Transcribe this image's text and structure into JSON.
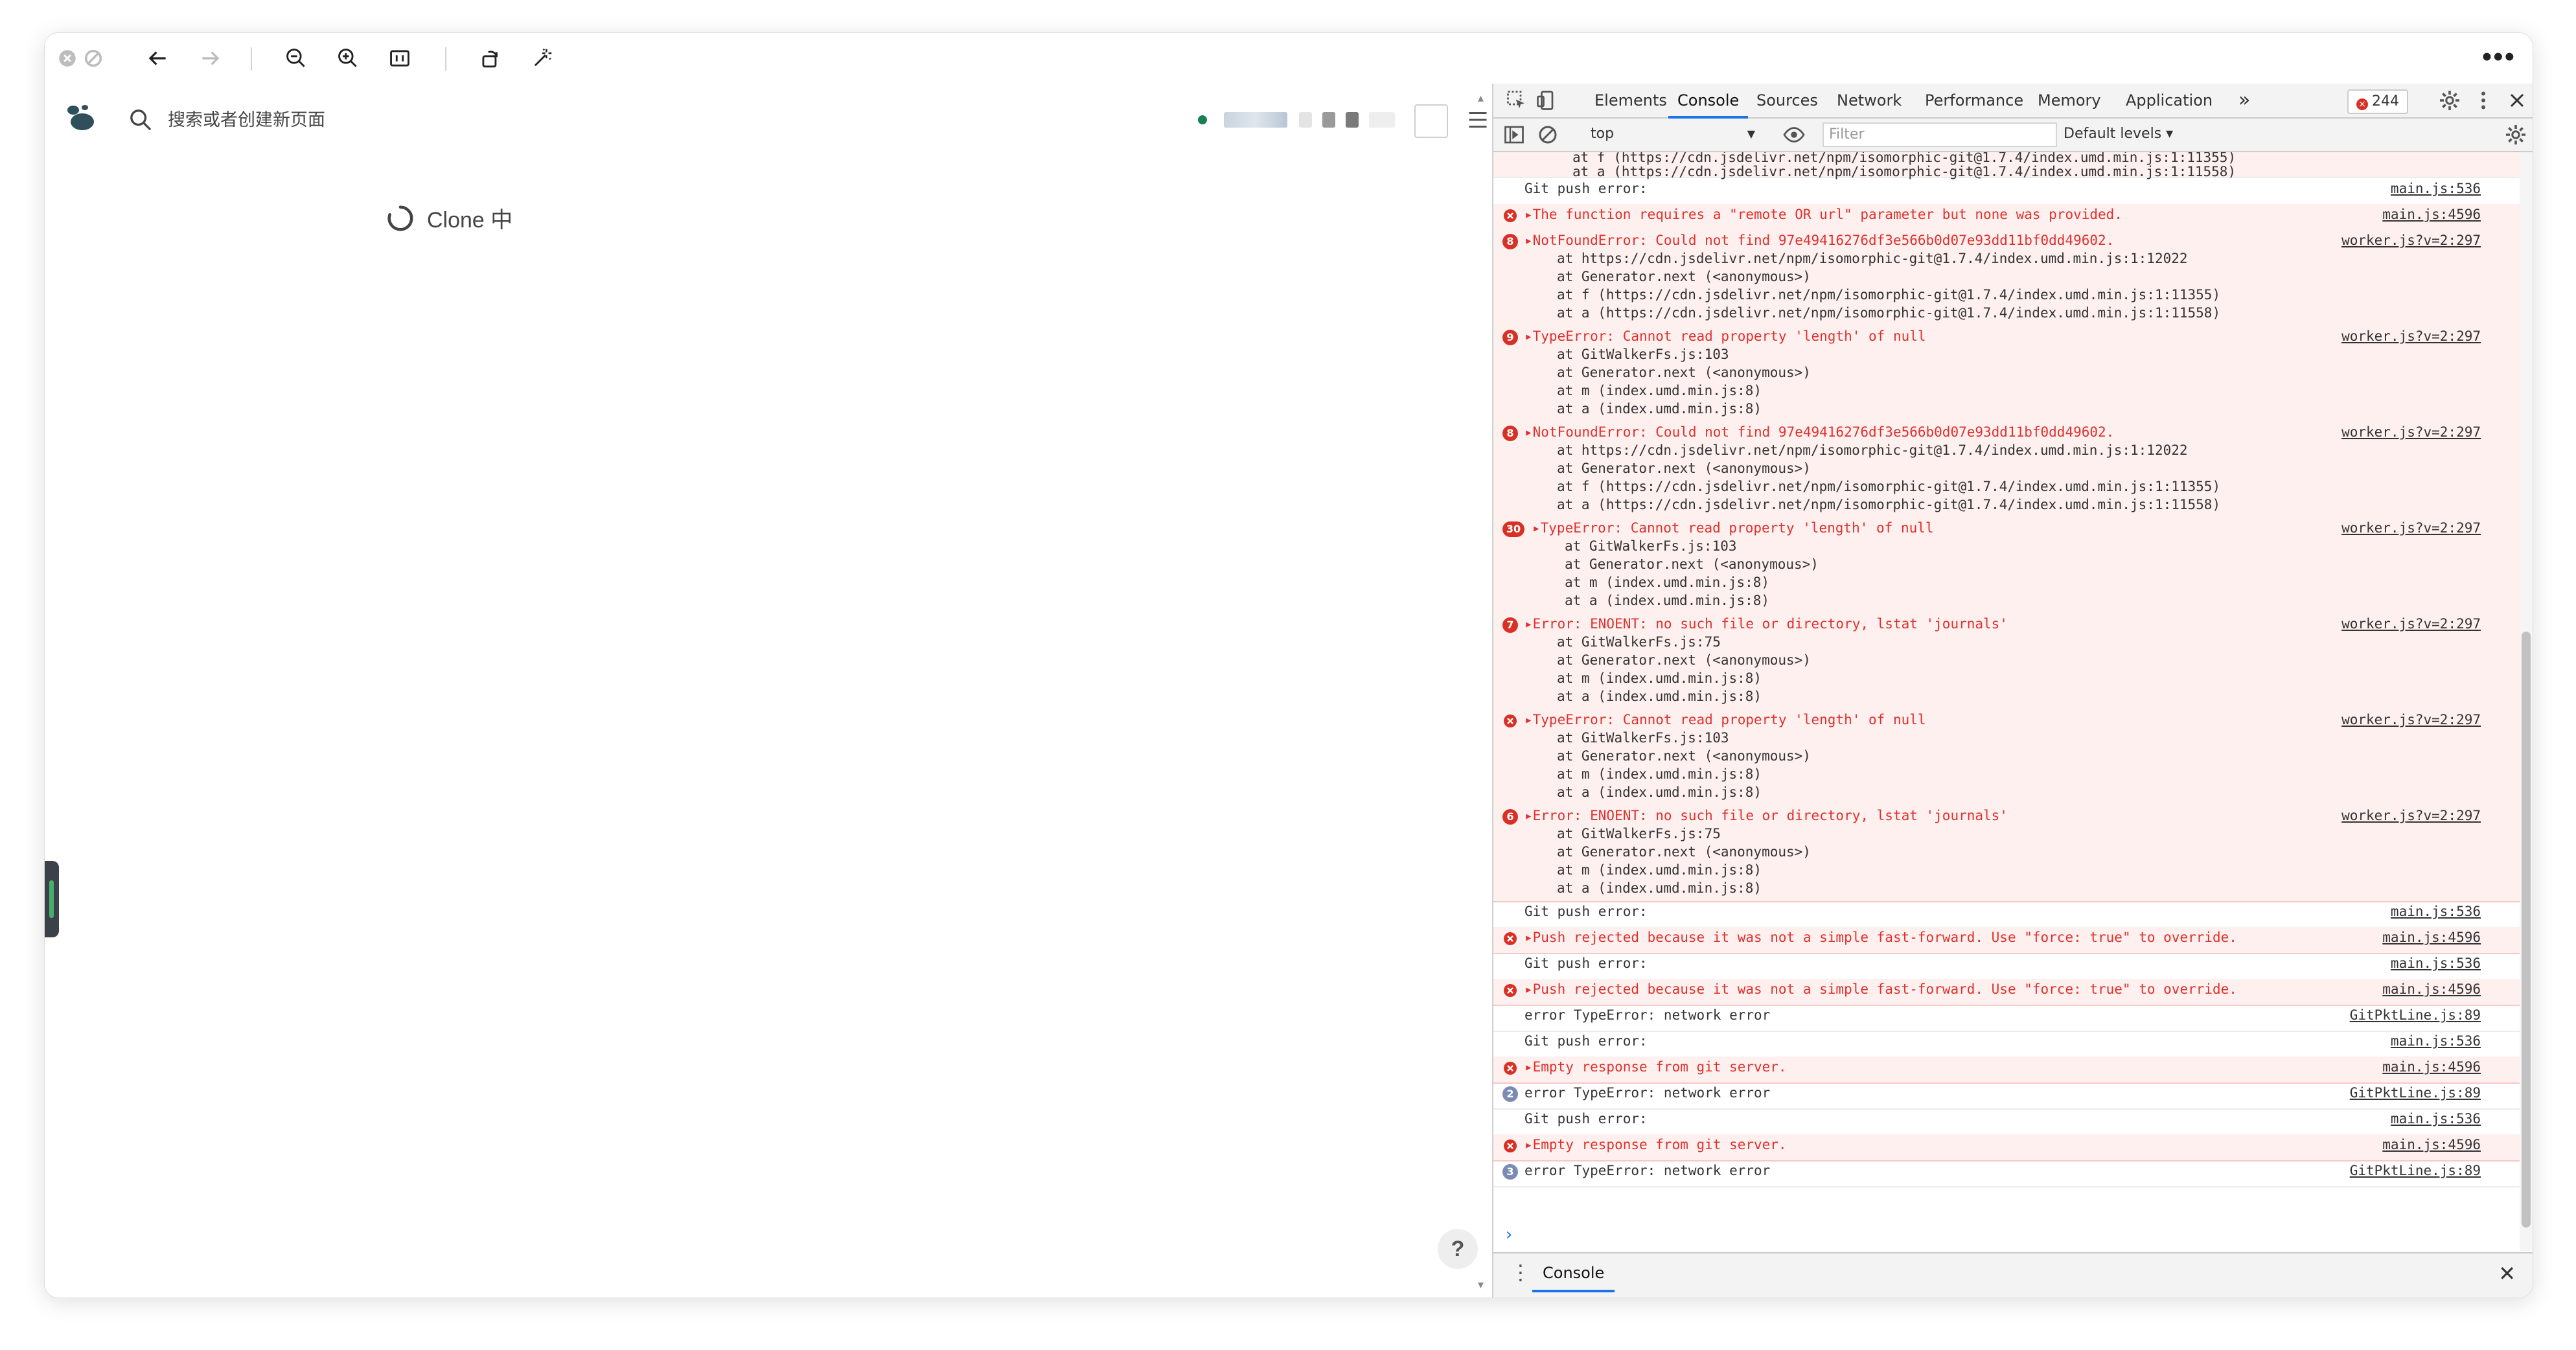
{
  "window": {
    "more_menu": "•••"
  },
  "left_pane": {
    "search_placeholder": "搜索或者创建新页面",
    "status_text": "Clone 中",
    "help_label": "?"
  },
  "devtools": {
    "tabs": [
      "Elements",
      "Console",
      "Sources",
      "Network",
      "Performance",
      "Memory",
      "Application"
    ],
    "overflow": "»",
    "error_count": "244",
    "context": "top",
    "filter_placeholder": "Filter",
    "levels": "Default levels ▾",
    "drawer_tab": "Console",
    "prompt": "›"
  },
  "console": {
    "top_partial": [
      "at f (https://cdn.jsdelivr.net/npm/isomorphic-git@1.7.4/index.umd.min.js:1:11355)",
      "at a (https://cdn.jsdelivr.net/npm/isomorphic-git@1.7.4/index.umd.min.js:1:11558)"
    ],
    "rows": [
      {
        "kind": "log",
        "msg": "Git push error:",
        "src": "main.js:536"
      },
      {
        "kind": "err",
        "icon": "x",
        "msg": "▸The function requires a \"remote OR url\" parameter but none was provided.",
        "src": "main.js:4596"
      },
      {
        "kind": "err",
        "icon": "8",
        "msg": "▸NotFoundError: Could not find 97e49416276df3e566b0d07e93dd11bf0dd49602.",
        "src": "worker.js?v=2:297",
        "lines": [
          "at https://cdn.jsdelivr.net/npm/isomorphic-git@1.7.4/index.umd.min.js:1:12022",
          "at Generator.next (<anonymous>)",
          "at f (https://cdn.jsdelivr.net/npm/isomorphic-git@1.7.4/index.umd.min.js:1:11355)",
          "at a (https://cdn.jsdelivr.net/npm/isomorphic-git@1.7.4/index.umd.min.js:1:11558)"
        ]
      },
      {
        "kind": "err",
        "icon": "9",
        "msg": "▸TypeError: Cannot read property 'length' of null",
        "src": "worker.js?v=2:297",
        "lines": [
          "at GitWalkerFs.js:103",
          "at Generator.next (<anonymous>)",
          "at m (index.umd.min.js:8)",
          "at a (index.umd.min.js:8)"
        ]
      },
      {
        "kind": "err",
        "icon": "8",
        "msg": "▸NotFoundError: Could not find 97e49416276df3e566b0d07e93dd11bf0dd49602.",
        "src": "worker.js?v=2:297",
        "lines": [
          "at https://cdn.jsdelivr.net/npm/isomorphic-git@1.7.4/index.umd.min.js:1:12022",
          "at Generator.next (<anonymous>)",
          "at f (https://cdn.jsdelivr.net/npm/isomorphic-git@1.7.4/index.umd.min.js:1:11355)",
          "at a (https://cdn.jsdelivr.net/npm/isomorphic-git@1.7.4/index.umd.min.js:1:11558)"
        ]
      },
      {
        "kind": "err",
        "icon": "30",
        "msg": "▸TypeError: Cannot read property 'length' of null",
        "src": "worker.js?v=2:297",
        "lines": [
          "at GitWalkerFs.js:103",
          "at Generator.next (<anonymous>)",
          "at m (index.umd.min.js:8)",
          "at a (index.umd.min.js:8)"
        ]
      },
      {
        "kind": "err",
        "icon": "7",
        "msg": "▸Error: ENOENT: no such file or directory, lstat 'journals'",
        "src": "worker.js?v=2:297",
        "lines": [
          "at GitWalkerFs.js:75",
          "at Generator.next (<anonymous>)",
          "at m (index.umd.min.js:8)",
          "at a (index.umd.min.js:8)"
        ]
      },
      {
        "kind": "err",
        "icon": "x",
        "msg": "▸TypeError: Cannot read property 'length' of null",
        "src": "worker.js?v=2:297",
        "lines": [
          "at GitWalkerFs.js:103",
          "at Generator.next (<anonymous>)",
          "at m (index.umd.min.js:8)",
          "at a (index.umd.min.js:8)"
        ]
      },
      {
        "kind": "err",
        "icon": "6",
        "msg": "▸Error: ENOENT: no such file or directory, lstat 'journals'",
        "src": "worker.js?v=2:297",
        "lines": [
          "at GitWalkerFs.js:75",
          "at Generator.next (<anonymous>)",
          "at m (index.umd.min.js:8)",
          "at a (index.umd.min.js:8)"
        ]
      },
      {
        "kind": "log",
        "msg": "Git push error:",
        "src": "main.js:536"
      },
      {
        "kind": "err",
        "icon": "x",
        "msg": "▸Push rejected because it was not a simple fast-forward. Use \"force: true\" to override.",
        "src": "main.js:4596"
      },
      {
        "kind": "log",
        "msg": "Git push error:",
        "src": "main.js:536"
      },
      {
        "kind": "err",
        "icon": "x",
        "msg": "▸Push rejected because it was not a simple fast-forward. Use \"force: true\" to override.",
        "src": "main.js:4596"
      },
      {
        "kind": "log",
        "msg": "error TypeError: network error",
        "src": "GitPktLine.js:89"
      },
      {
        "kind": "log",
        "msg": "Git push error:",
        "src": "main.js:536"
      },
      {
        "kind": "err",
        "icon": "x",
        "msg": "▸Empty response from git server.",
        "src": "main.js:4596"
      },
      {
        "kind": "log",
        "icon": "2",
        "msg": "error TypeError: network error",
        "src": "GitPktLine.js:89"
      },
      {
        "kind": "log",
        "msg": "Git push error:",
        "src": "main.js:536"
      },
      {
        "kind": "err",
        "icon": "x",
        "msg": "▸Empty response from git server.",
        "src": "main.js:4596"
      },
      {
        "kind": "log",
        "icon": "3",
        "msg": "error TypeError: network error",
        "src": "GitPktLine.js:89"
      }
    ]
  }
}
